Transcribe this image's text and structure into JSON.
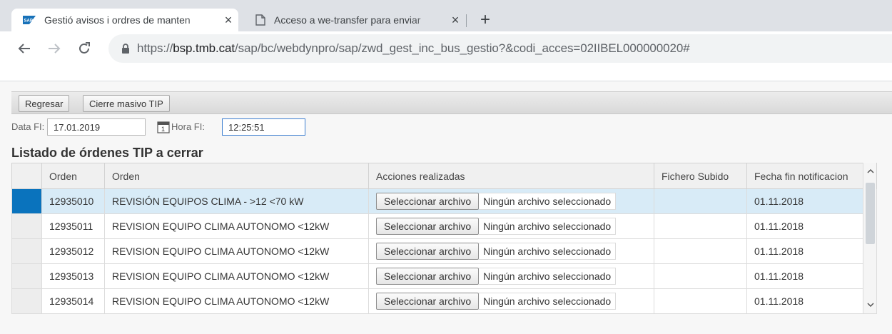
{
  "browser": {
    "tabs": [
      {
        "title": "Gestió avisos i ordres de manten",
        "favicon": "sap-icon",
        "close": "×",
        "active": true
      },
      {
        "title": "Acceso a we-transfer para enviar",
        "favicon": "document-icon",
        "close": "×",
        "active": false
      }
    ],
    "new_tab": "+",
    "url_scheme": "https://",
    "url_host": "bsp.tmb.cat",
    "url_path": "/sap/bc/webdynpro/sap/zwd_gest_inc_bus_gestio?&codi_acces=02IIBEL000000020#"
  },
  "toolbar": {
    "back_label": "Regresar",
    "mass_close_label": "Cierre masivo TIP"
  },
  "filters": {
    "date_label": "Data FI:",
    "date_value": "17.01.2019",
    "time_label": "Hora FI:",
    "time_value": "12:25:51"
  },
  "list": {
    "title": "Listado de órdenes TIP a cerrar",
    "columns": [
      "Orden",
      "Orden",
      "Acciones realizadas",
      "Fichero Subido",
      "Fecha fin notificacion"
    ],
    "file_button_label": "Seleccionar archivo",
    "no_file_text": "Ningún archivo seleccionado",
    "rows": [
      {
        "order": "12935010",
        "description": "REVISIÓN EQUIPOS CLIMA - >12 <70 kW",
        "file": "",
        "date": "01.11.2018"
      },
      {
        "order": "12935011",
        "description": "REVISION EQUIPO CLIMA AUTONOMO <12kW",
        "file": "",
        "date": "01.11.2018"
      },
      {
        "order": "12935012",
        "description": "REVISION EQUIPO CLIMA AUTONOMO <12kW",
        "file": "",
        "date": "01.11.2018"
      },
      {
        "order": "12935013",
        "description": "REVISION EQUIPO CLIMA AUTONOMO <12kW",
        "file": "",
        "date": "01.11.2018"
      },
      {
        "order": "12935014",
        "description": "REVISION EQUIPO CLIMA AUTONOMO <12kW",
        "file": "",
        "date": "01.11.2018"
      }
    ],
    "selected_row_index": 0
  },
  "colors": {
    "selection_marker": "#0a73bd",
    "selected_row": "#d8ebf7",
    "input_focus_border": "#3c7ed0"
  }
}
